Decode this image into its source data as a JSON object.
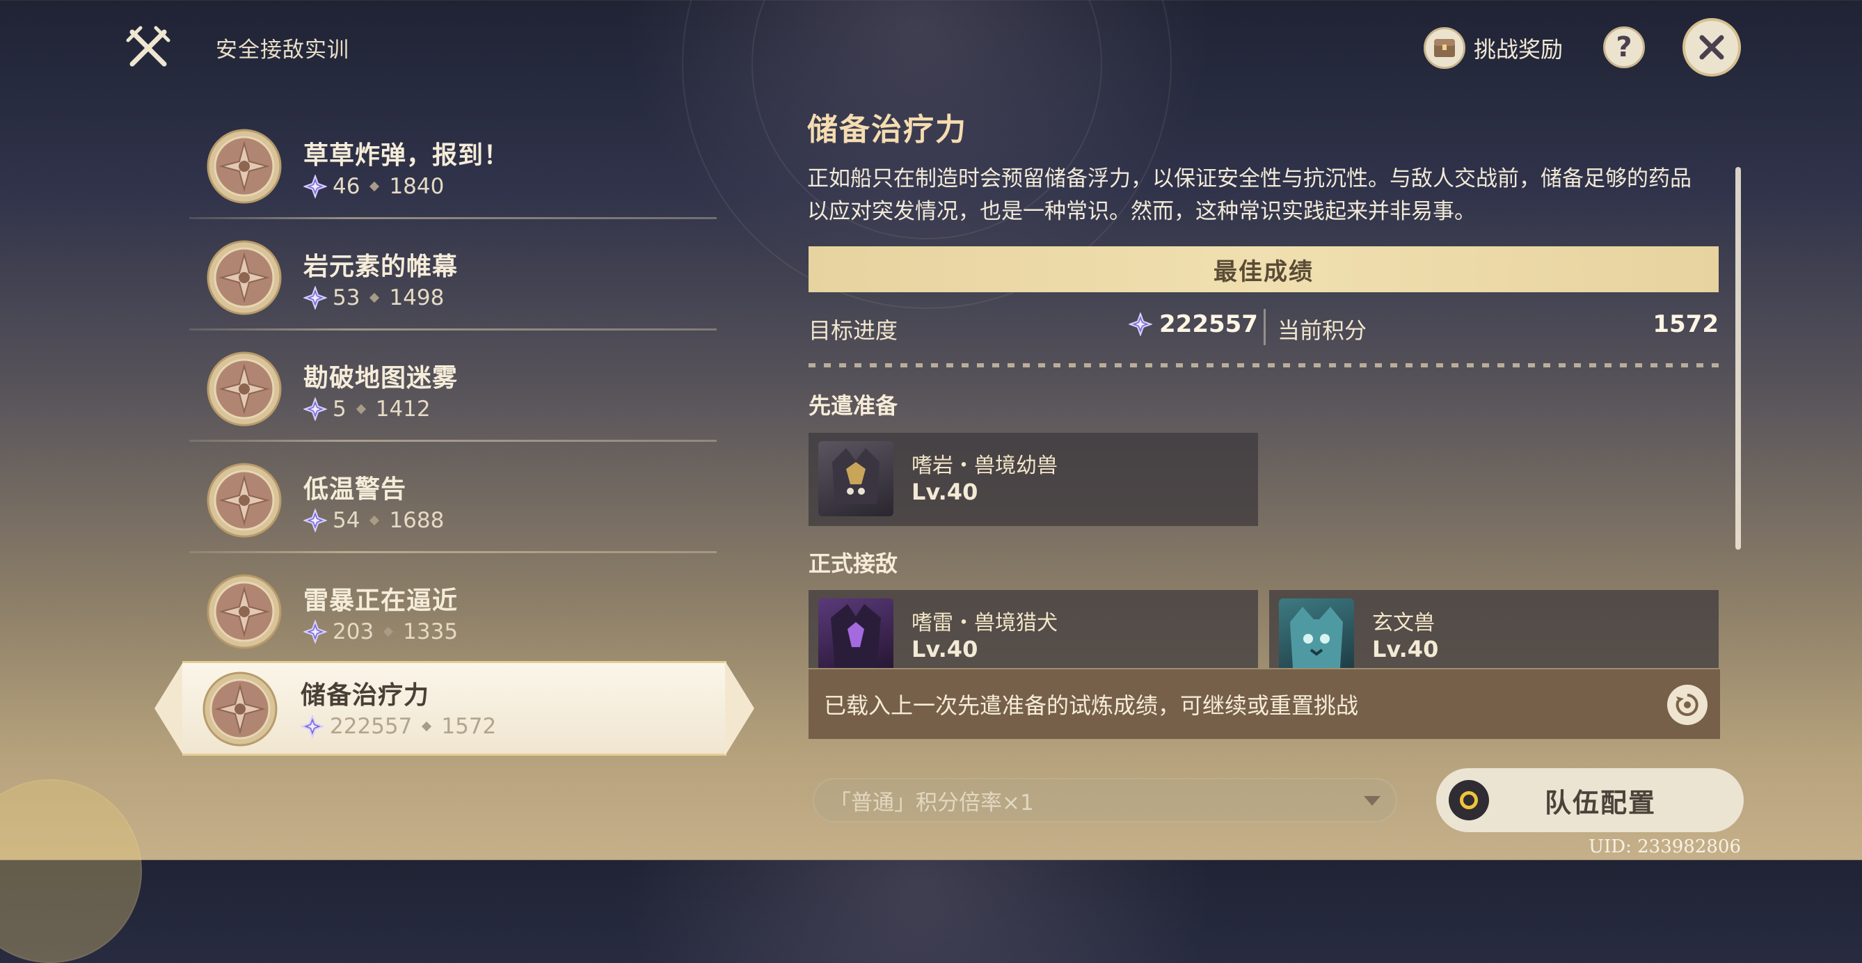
{
  "header": {
    "mode_title": "安全接敌实训",
    "reward_label": "挑战奖励",
    "help_glyph": "?"
  },
  "challenges": [
    {
      "title": "草草炸弹，报到！",
      "target": "46",
      "score": "1840"
    },
    {
      "title": "岩元素的帷幕",
      "target": "53",
      "score": "1498"
    },
    {
      "title": "勘破地图迷雾",
      "target": "5",
      "score": "1412"
    },
    {
      "title": "低温警告",
      "target": "54",
      "score": "1688"
    },
    {
      "title": "雷暴正在逼近",
      "target": "203",
      "score": "1335"
    },
    {
      "title": "储备治疗力",
      "target": "222557",
      "score": "1572",
      "selected": true
    }
  ],
  "detail": {
    "title": "储备治疗力",
    "description": "正如船只在制造时会预留储备浮力，以保证安全性与抗沉性。与敌人交战前，储备足够的药品以应对突发情况，也是一种常识。然而，这种常识实践起来并非易事。",
    "best_label": "最佳成绩",
    "target_label": "目标进度",
    "target_value": "222557",
    "current_label": "当前积分",
    "current_value": "1572",
    "vanguard_label": "先遣准备",
    "main_label": "正式接敌",
    "vanguard_enemies": [
      {
        "name": "嗜岩・兽境幼兽",
        "level": "Lv.40"
      }
    ],
    "main_enemies": [
      {
        "name": "嗜雷・兽境猎犬",
        "level": "Lv.40"
      },
      {
        "name": "玄文兽",
        "level": "Lv.40"
      }
    ],
    "notice": "已载入上一次先遣准备的试炼成绩，可继续或重置挑战"
  },
  "multiplier": {
    "selected": "「普通」积分倍率×1"
  },
  "team_button": "队伍配置",
  "uid": "UID: 233982806",
  "colors": {
    "accent_gold": "#e7d39f",
    "notice_bg": "#766049",
    "gem_purple": "#7b6cd6"
  }
}
